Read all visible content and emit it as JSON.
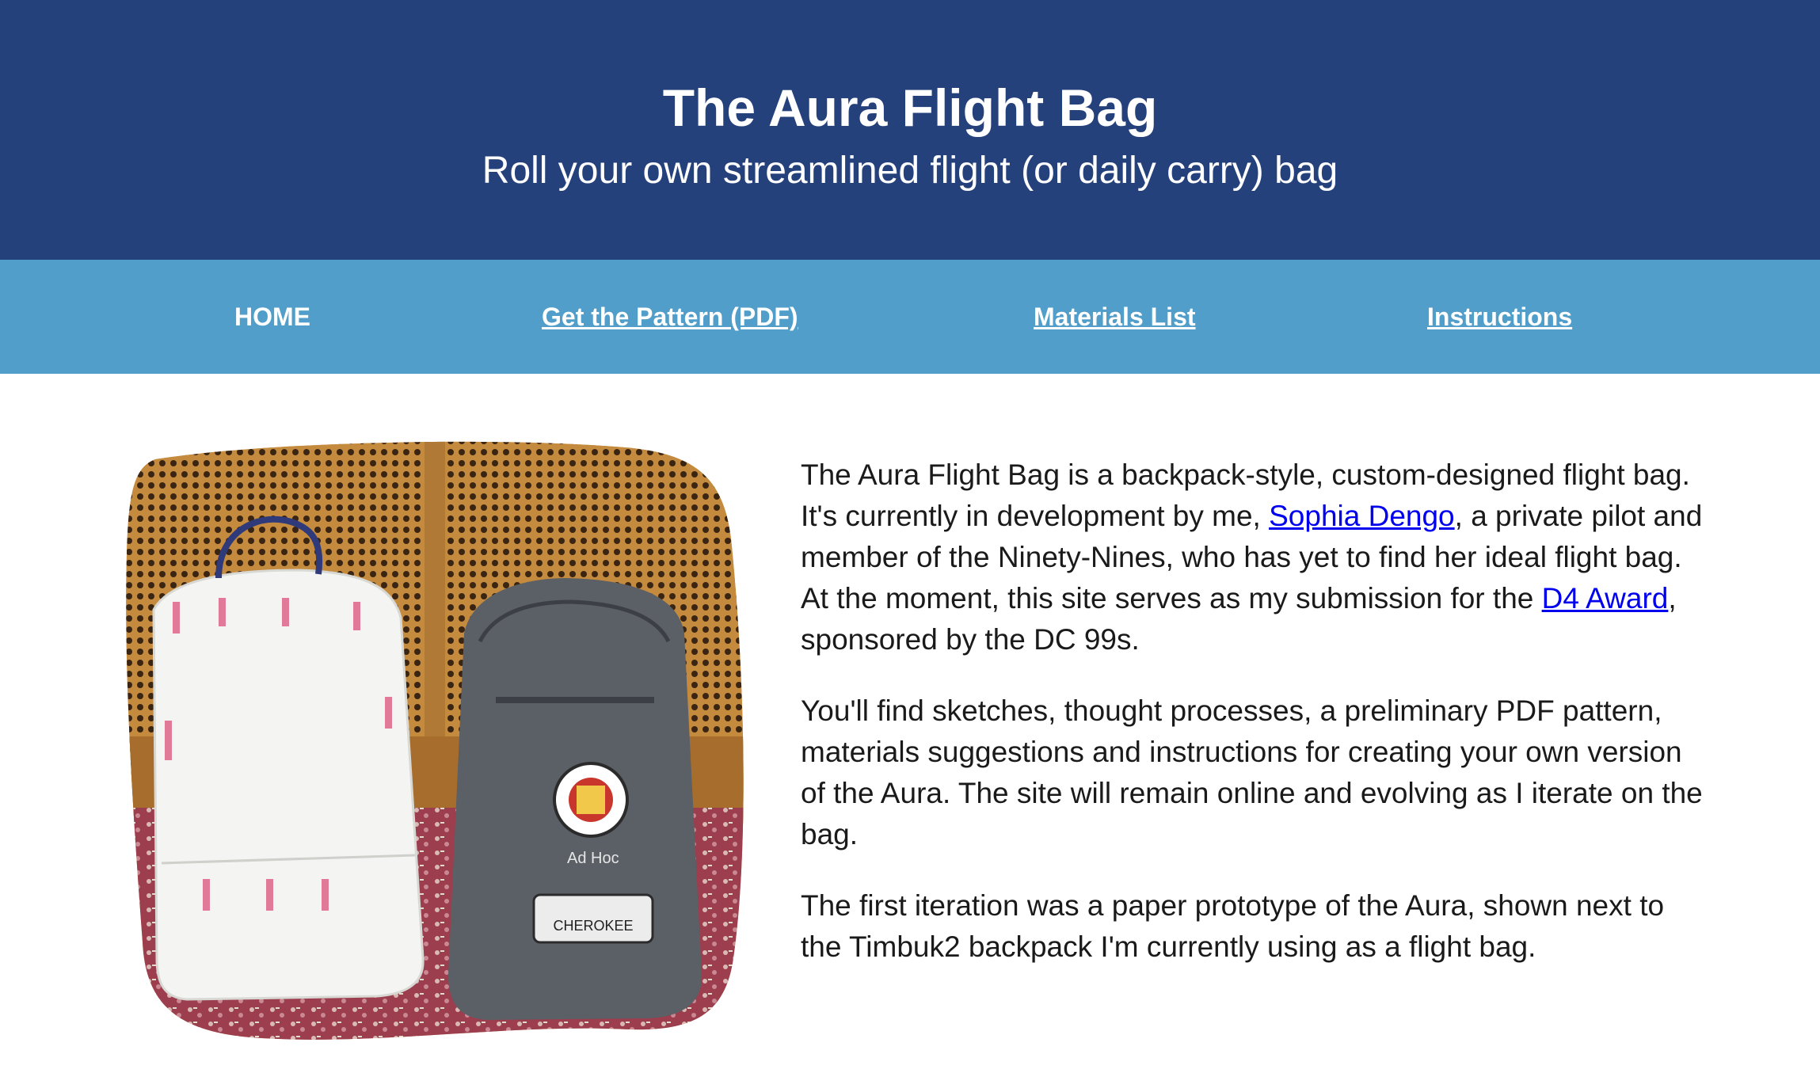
{
  "header": {
    "title": "The Aura Flight Bag",
    "subtitle": "Roll your own streamlined flight (or daily carry) bag"
  },
  "nav": {
    "items": [
      {
        "label": "HOME"
      },
      {
        "label": "Get the Pattern (PDF)"
      },
      {
        "label": "Materials List"
      },
      {
        "label": "Instructions"
      }
    ]
  },
  "content": {
    "p1": {
      "before_link": "The Aura Flight Bag is a backpack-style, custom-designed flight bag. It's currently in development by me, ",
      "link1": "Sophia Dengo",
      "middle": ", a private pilot and member of the Ninety-Nines, who has yet to find her ideal flight bag. At the moment, this site serves as my submission for the ",
      "link2": "D4 Award",
      "after_link": ", sponsored by the DC 99s."
    },
    "p2": "You'll find sketches, thought processes, a preliminary PDF pattern, materials suggestions and instructions for creating your own version of the Aura. The site will remain online and evolving as I iterate on the bag.",
    "p3": "The first iteration was a paper prototype of the Aura, shown next to the Timbuk2 backpack I'm currently using as a flight bag.",
    "photo": {
      "patch_label": "CHEROKEE",
      "tag_label": "Ad Hoc"
    }
  },
  "colors": {
    "header_bg": "#25417c",
    "nav_bg": "#509ec9",
    "link": "#0000ee"
  }
}
